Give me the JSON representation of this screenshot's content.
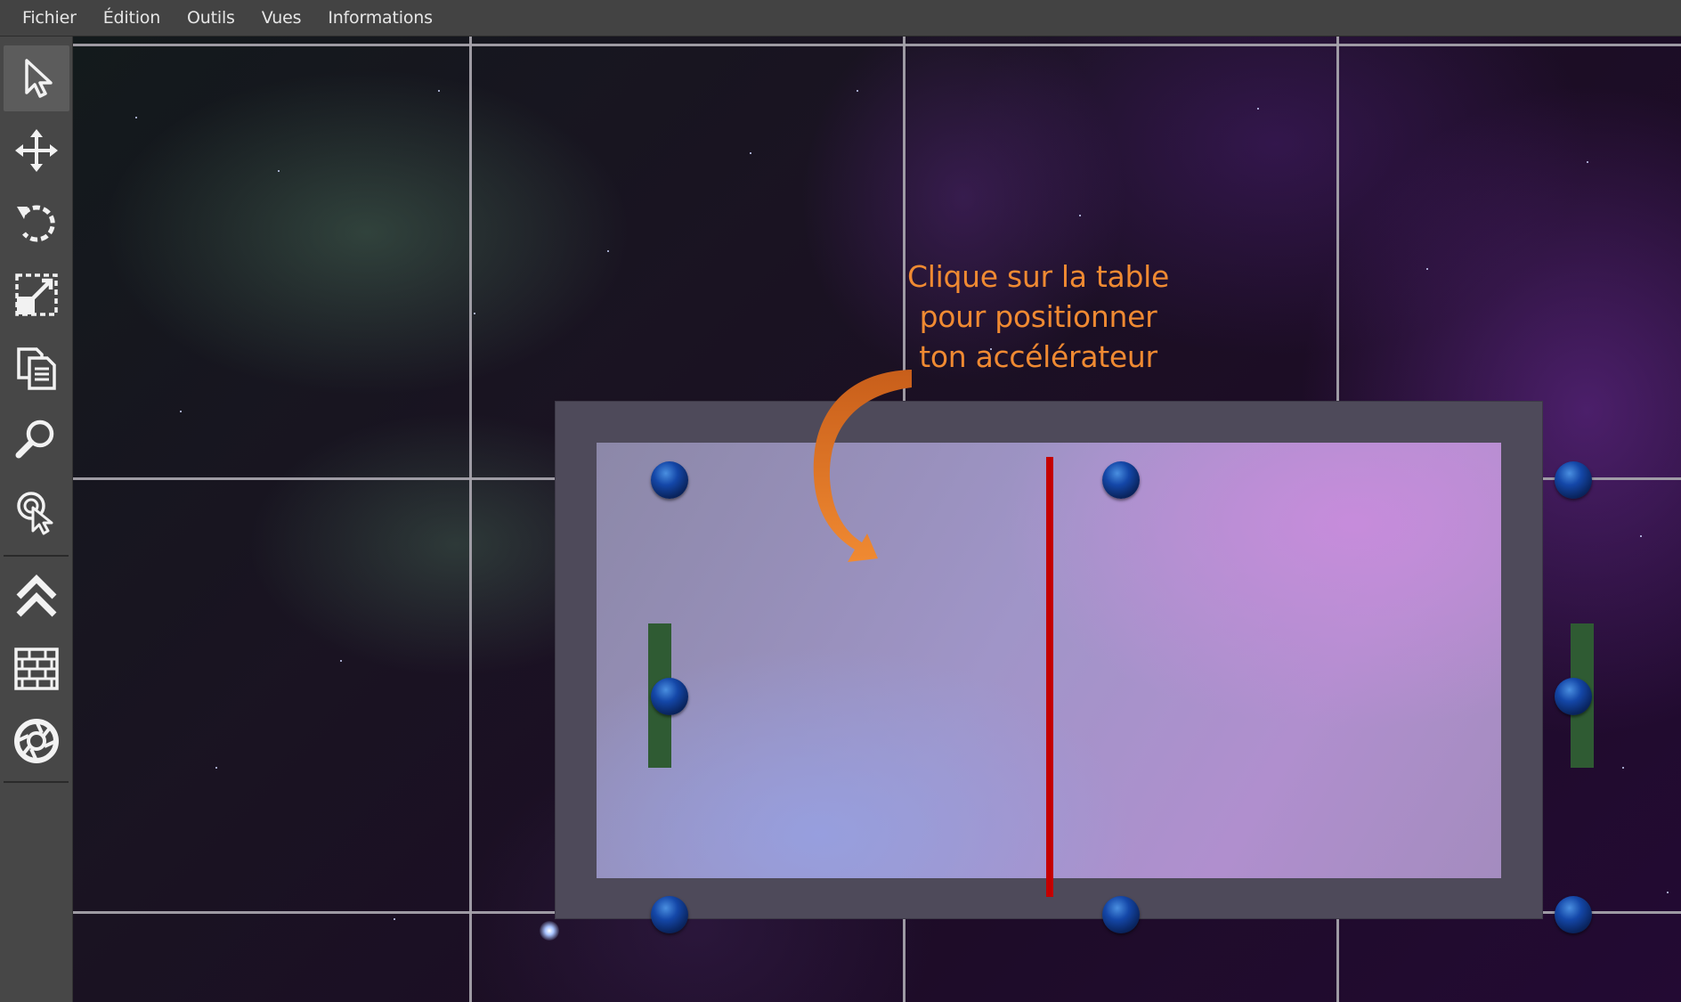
{
  "menu": {
    "items": [
      "Fichier",
      "Édition",
      "Outils",
      "Vues",
      "Informations"
    ]
  },
  "toolbar": {
    "tools": [
      {
        "icon": "select-arrow-icon",
        "active": true
      },
      {
        "icon": "move-icon"
      },
      {
        "icon": "rotate-icon"
      },
      {
        "icon": "scale-icon"
      },
      {
        "icon": "duplicate-icon"
      },
      {
        "icon": "zoom-icon"
      },
      {
        "icon": "select-click-icon"
      },
      {
        "icon": "double-chevron-up-icon"
      },
      {
        "icon": "brick-wall-icon"
      },
      {
        "icon": "portal-icon"
      }
    ]
  },
  "viewport": {
    "annotation": {
      "lines": [
        "Clique sur la table",
        "pour positionner",
        "ton accélérateur"
      ],
      "color": "#f08a32"
    },
    "table": {
      "frame_color": "#4e4a5a",
      "midline_color": "#c40000",
      "goal_color": "#2f5b33",
      "control_point_color": "#1447a8"
    }
  }
}
